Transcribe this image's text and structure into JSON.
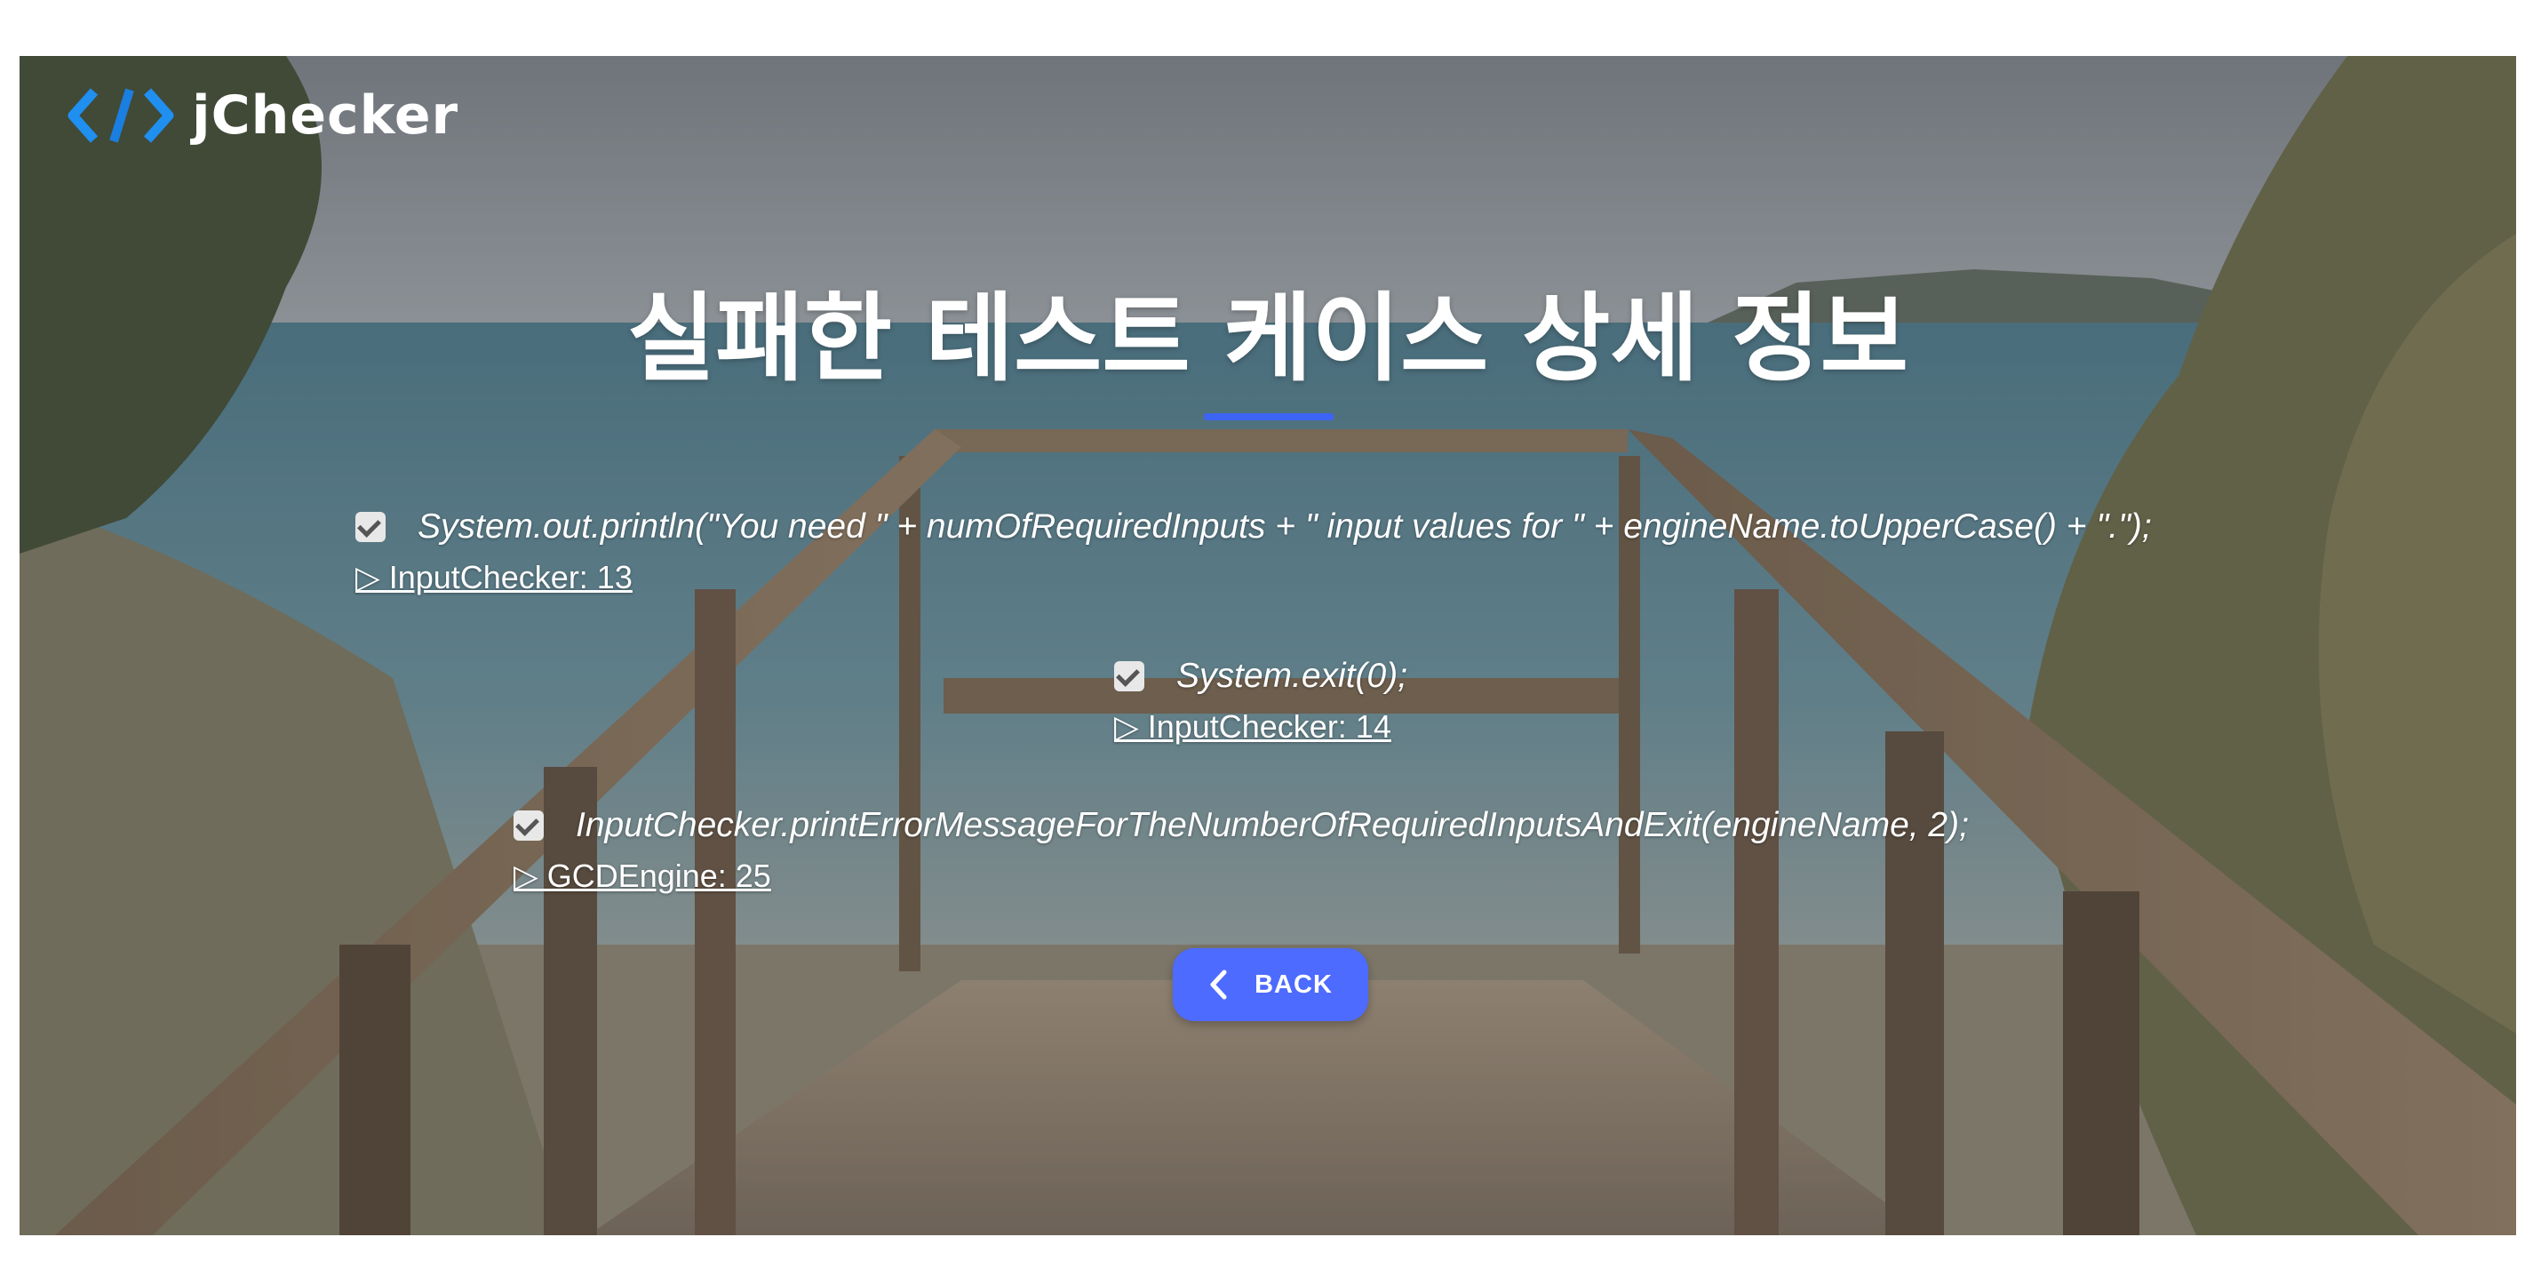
{
  "brand": {
    "name": "jChecker",
    "icon": "code-brackets-icon",
    "accent": "#1f8ff0"
  },
  "page": {
    "title": "실패한 테스트 케이스 상세 정보",
    "underline_color": "#3d64f5"
  },
  "failures": [
    {
      "code": "System.out.println(\"You need \" + numOfRequiredInputs + \" input values for \" + engineName.toUpperCase() + \".\");",
      "link": "▷ InputChecker: 13"
    },
    {
      "code": "System.exit(0);",
      "link": "▷ InputChecker: 14"
    },
    {
      "code": "InputChecker.printErrorMessageForTheNumberOfRequiredInputsAndExit(engineName, 2);",
      "link": "▷ GCDEngine: 25"
    }
  ],
  "back_button": {
    "label": "BACK",
    "icon": "chevron-left-icon",
    "color": "#4d6bff"
  }
}
